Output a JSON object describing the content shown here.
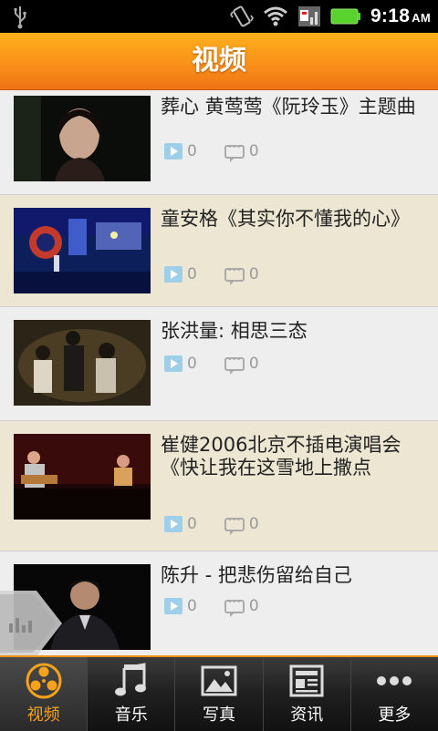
{
  "status_bar": {
    "time": "9:18",
    "ampm": "AM",
    "icons": [
      "usb-icon",
      "vibrate-icon",
      "wifi-icon",
      "signal-icon",
      "battery-icon"
    ]
  },
  "header": {
    "title": "视频"
  },
  "colors": {
    "accent": "#f7a21b",
    "header_top": "#ffb01c",
    "header_bottom": "#ef7414",
    "tabbar": "#1f1f1f"
  },
  "videos": [
    {
      "title": "葬心 黄莺莺《阮玲玉》主题曲",
      "plays": "0",
      "comments": "0"
    },
    {
      "title": "童安格《其实你不懂我的心》",
      "plays": "0",
      "comments": "0"
    },
    {
      "title": "张洪量: 相思三态",
      "plays": "0",
      "comments": "0"
    },
    {
      "title": "崔健2006北京不插电演唱会《快让我在这雪地上撒点",
      "plays": "0",
      "comments": "0"
    },
    {
      "title": "陈升 - 把悲伤留给自己",
      "plays": "0",
      "comments": "0"
    }
  ],
  "tabs": [
    {
      "label": "视频",
      "icon": "film-reel-icon",
      "active": true
    },
    {
      "label": "音乐",
      "icon": "music-note-icon",
      "active": false
    },
    {
      "label": "写真",
      "icon": "picture-icon",
      "active": false
    },
    {
      "label": "资讯",
      "icon": "newspaper-icon",
      "active": false
    },
    {
      "label": "更多",
      "icon": "more-dots-icon",
      "active": false
    }
  ]
}
